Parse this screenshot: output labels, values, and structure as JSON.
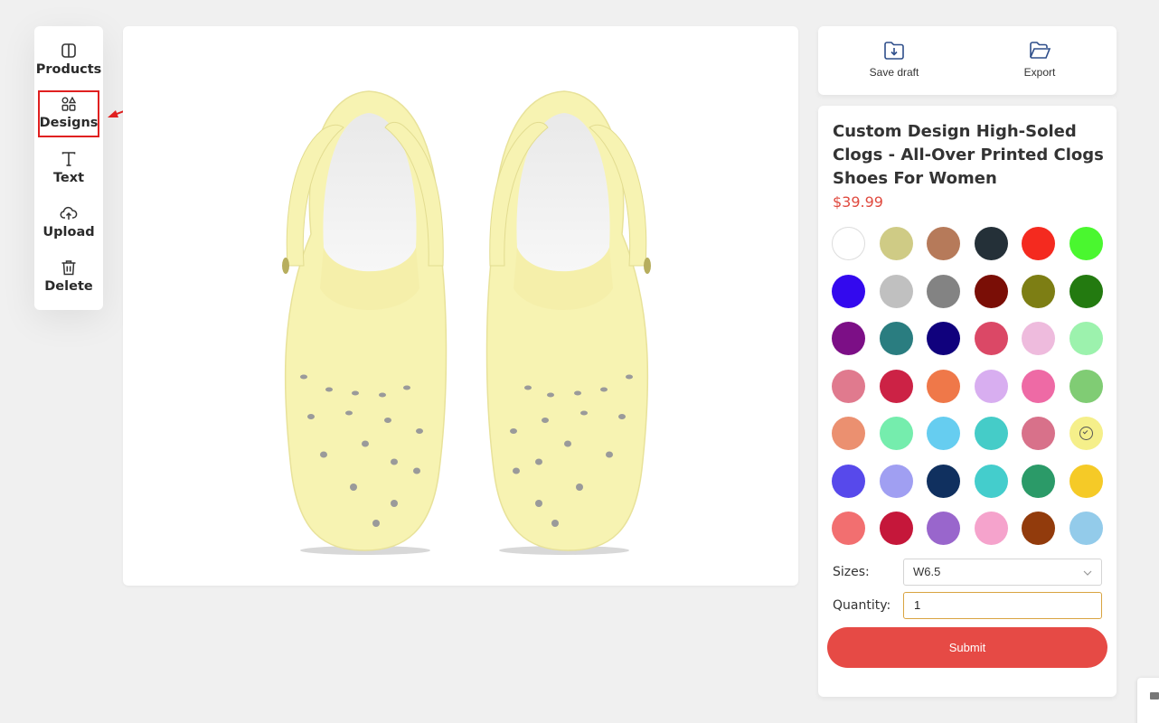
{
  "toolbar": {
    "items": [
      {
        "label": "Products",
        "icon": "panel-icon"
      },
      {
        "label": "Designs",
        "icon": "shapes-icon"
      },
      {
        "label": "Text",
        "icon": "text-icon"
      },
      {
        "label": "Upload",
        "icon": "cloud-upload-icon"
      },
      {
        "label": "Delete",
        "icon": "trash-icon"
      }
    ]
  },
  "actions": {
    "save_draft": "Save draft",
    "export": "Export"
  },
  "product": {
    "title": "Custom Design High-Soled Clogs - All-Over Printed Clogs Shoes For Women",
    "price": "$39.99",
    "shoe_color": "#f7f3b2",
    "colors": [
      "#ffffff",
      "#cfcb85",
      "#b67a5a",
      "#243038",
      "#f42a1f",
      "#4af72f",
      "#3309ee",
      "#c0c0c0",
      "#838383",
      "#7a0e06",
      "#7d7e14",
      "#237a10",
      "#7c0f86",
      "#2a7d80",
      "#10017d",
      "#db4866",
      "#eebbdd",
      "#9cf2ad",
      "#e07a8e",
      "#cc2245",
      "#ef7849",
      "#d8aef0",
      "#ee6aa5",
      "#80cc74",
      "#eb9070",
      "#75edad",
      "#66cdf0",
      "#45ccc8",
      "#d8718a",
      "#f5ef8a",
      "#5749eb",
      "#a09ff2",
      "#10305f",
      "#44cdcc",
      "#2b9a68",
      "#f5ca27",
      "#f26f70",
      "#c5173a",
      "#9966cc",
      "#f5a3cc",
      "#923b0c",
      "#93cbea"
    ],
    "selected_color_index": 29
  },
  "form": {
    "sizes_label": "Sizes:",
    "size_value": "W6.5",
    "quantity_label": "Quantity:",
    "quantity_value": "1",
    "submit_label": "Submit"
  }
}
